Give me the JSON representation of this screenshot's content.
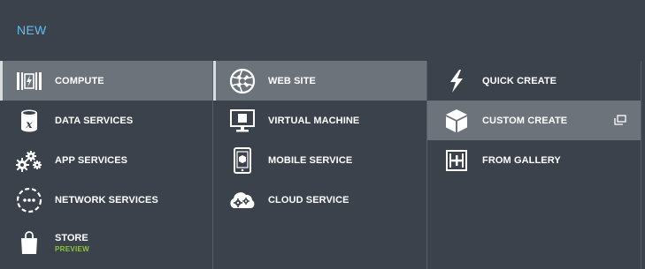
{
  "header": {
    "title": "NEW"
  },
  "categories": [
    {
      "label": "COMPUTE",
      "icon": "compute-icon"
    },
    {
      "label": "DATA SERVICES",
      "icon": "database-icon"
    },
    {
      "label": "APP SERVICES",
      "icon": "gears-icon"
    },
    {
      "label": "NETWORK SERVICES",
      "icon": "network-icon"
    },
    {
      "label": "STORE",
      "sublabel": "PREVIEW",
      "icon": "shopping-bag-icon"
    }
  ],
  "services": [
    {
      "label": "WEB SITE",
      "icon": "globe-icon"
    },
    {
      "label": "VIRTUAL MACHINE",
      "icon": "monitor-icon"
    },
    {
      "label": "MOBILE SERVICE",
      "icon": "mobile-icon"
    },
    {
      "label": "CLOUD SERVICE",
      "icon": "cloud-gears-icon"
    }
  ],
  "options": [
    {
      "label": "QUICK CREATE",
      "icon": "lightning-icon"
    },
    {
      "label": "CUSTOM CREATE",
      "icon": "cube-icon"
    },
    {
      "label": "FROM GALLERY",
      "icon": "gallery-icon"
    }
  ],
  "colors": {
    "accent": "#5fc0ef",
    "preview": "#8cc63f",
    "selected": "#6c737b",
    "background": "#3b424c"
  }
}
